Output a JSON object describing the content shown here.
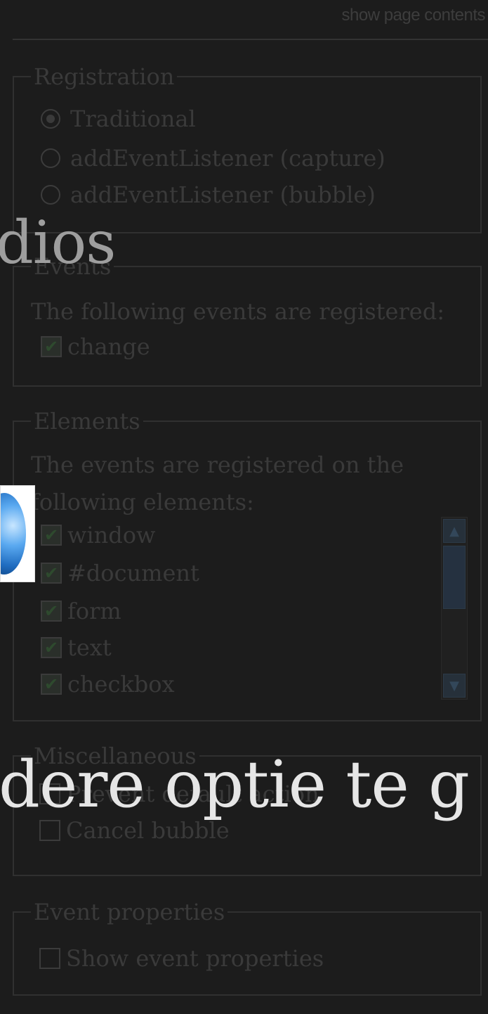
{
  "header": {
    "show_contents_label": "show page contents"
  },
  "registration": {
    "legend": "Registration",
    "options": [
      {
        "label": "Traditional",
        "selected": true
      },
      {
        "label": "addEventListener (capture)",
        "selected": false
      },
      {
        "label": "addEventListener (bubble)",
        "selected": false
      }
    ]
  },
  "events": {
    "legend": "Events",
    "text": "The following events are registered:",
    "items": [
      {
        "label": "change",
        "checked": true
      }
    ]
  },
  "elements": {
    "legend": "Elements",
    "text_line1": "The events are registered on the",
    "text_line2": "following elements:",
    "items": [
      {
        "label": "window",
        "checked": true
      },
      {
        "label": "#document",
        "checked": true
      },
      {
        "label": "form",
        "checked": true
      },
      {
        "label": "text",
        "checked": true
      },
      {
        "label": "checkbox",
        "checked": true
      }
    ]
  },
  "misc": {
    "legend": "Miscellaneous",
    "items": [
      {
        "label": "Prevent default action",
        "checked": false
      },
      {
        "label": "Cancel bubble",
        "checked": false
      }
    ]
  },
  "event_properties": {
    "legend": "Event properties",
    "items": [
      {
        "label": "Show event properties",
        "checked": false
      }
    ]
  },
  "overlay": {
    "top_text": "dios",
    "bottom_text": "dere optie te g"
  },
  "icons": {
    "check": "checkmark-icon",
    "scroll_up": "arrow-up-icon",
    "scroll_down": "arrow-down-icon"
  }
}
